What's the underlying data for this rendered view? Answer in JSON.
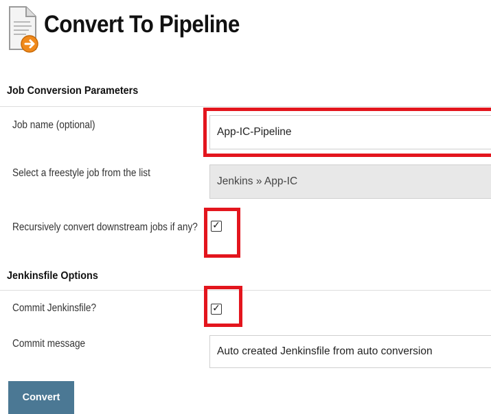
{
  "page": {
    "title": "Convert To Pipeline"
  },
  "sections": {
    "job_conversion": {
      "title": "Job Conversion Parameters",
      "job_name_label": "Job name (optional)",
      "job_name_value": "App-IC-Pipeline",
      "freestyle_label": "Select a freestyle job from the list",
      "freestyle_value": "Jenkins » App-IC",
      "recursive_label": "Recursively convert downstream jobs if any?",
      "recursive_checked": true
    },
    "jenkinsfile": {
      "title": "Jenkinsfile Options",
      "commit_label": "Commit Jenkinsfile?",
      "commit_checked": true,
      "message_label": "Commit message",
      "message_value": "Auto created Jenkinsfile from auto conversion"
    }
  },
  "actions": {
    "convert_label": "Convert"
  },
  "colors": {
    "highlight": "#e3151d",
    "button": "#4b7894",
    "readonly_field": "#e8e8e8"
  },
  "icons": {
    "header": "document-arrow-icon",
    "checkmark": "check-icon"
  }
}
